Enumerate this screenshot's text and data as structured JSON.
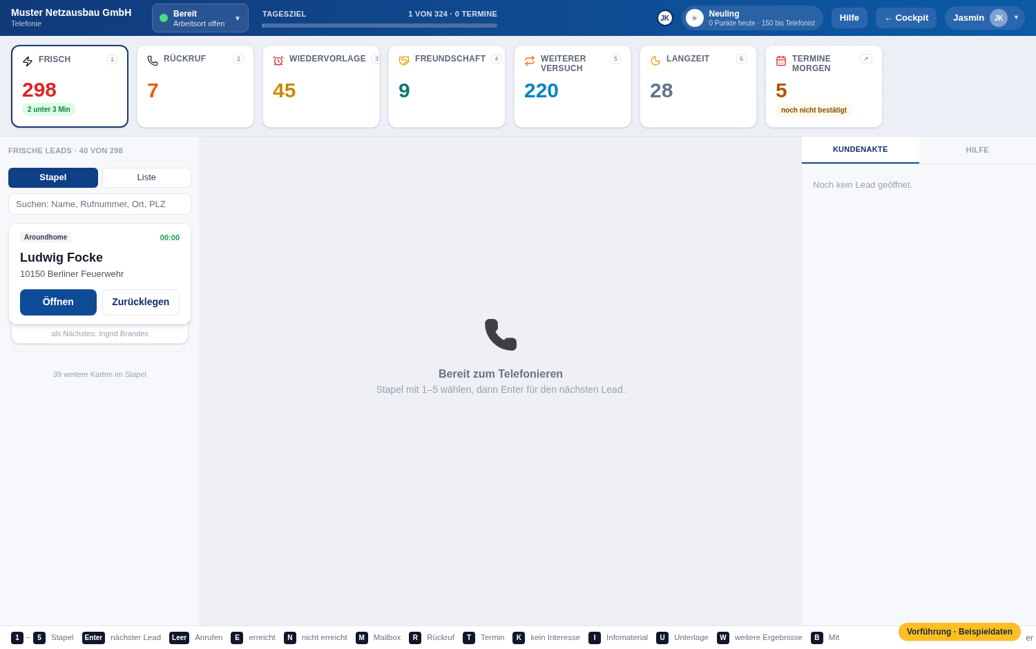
{
  "header": {
    "company": "Muster Netzausbau GmbH",
    "subtitle": "Telefonie",
    "status": {
      "label": "Bereit",
      "sublabel": "Arbeitsort offen",
      "color": "#4ade80",
      "caret": "▼"
    },
    "goal": {
      "label": "TAGESZIEL",
      "reading": "1 VON 324 · 0 TERMINE",
      "level": 0.003
    },
    "initials_badge": "JK",
    "rank": {
      "title": "Neuling",
      "detail": "0 Punkte heute · 150 bis Telefonist",
      "star": "★"
    },
    "buttons": [
      "Hilfe",
      "← Cockpit"
    ],
    "user": {
      "name": "Jasmin",
      "initials": "JK",
      "caret": "▼"
    }
  },
  "cards": [
    {
      "kind": "fresh",
      "title": "FRISCH",
      "shortcut": "1",
      "value": "298",
      "color": "#dc2626",
      "selected": true,
      "note": {
        "text": "2 unter 3 Min",
        "color": "#15803d"
      }
    },
    {
      "kind": "callback",
      "title": "RÜCKRUF",
      "shortcut": "2",
      "value": "7",
      "color": "#ea580c",
      "selected": false
    },
    {
      "kind": "followup",
      "title": "WIEDERVORLAGE",
      "shortcut": "3",
      "value": "45",
      "color": "#ca8a04",
      "selected": false
    },
    {
      "kind": "friendship",
      "title": "FREUNDSCHAFT",
      "shortcut": "4",
      "value": "9",
      "color": "#0f766e",
      "selected": false
    },
    {
      "kind": "retry",
      "title": "WEITERER VERSUCH",
      "shortcut": "5",
      "value": "220",
      "color": "#0284c7",
      "selected": false
    },
    {
      "kind": "longterm",
      "title": "LANGZEIT",
      "shortcut": "6",
      "value": "28",
      "color": "#64748b",
      "selected": false
    },
    {
      "kind": "appointments",
      "title": "TERMINE MORGEN",
      "shortcut": "↗",
      "value": "5",
      "color": "#b45309",
      "selected": false,
      "note": {
        "text": "noch nicht bestätigt",
        "color": "#854d0e"
      }
    }
  ],
  "left_panel": {
    "heading": "FRISCHE LEADS · 40 VON 298",
    "view_tabs": [
      {
        "label": "Stapel",
        "selected": true
      },
      {
        "label": "Liste",
        "selected": false
      }
    ],
    "search": {
      "placeholder": "Suchen: Name, Rufnummer, Ort, PLZ"
    },
    "lead": {
      "source": "Aroundhome",
      "timer": "00:00",
      "name": "Ludwig Focke",
      "address": "10150 Berliner Feuerwehr",
      "buttons": [
        {
          "label": "Öffnen",
          "selected": true
        },
        {
          "label": "Zurücklegen",
          "selected": false
        }
      ]
    },
    "next": "als Nächstes: Ingrid Brandes",
    "remaining": "39 weitere Karten im Stapel"
  },
  "center": {
    "title": "Bereit zum Telefonieren",
    "subtitle": "Stapel mit 1–5 wählen, dann Enter für den nächsten Lead."
  },
  "right_panel": {
    "tabs": [
      {
        "label": "KUNDENAKTE",
        "selected": true
      },
      {
        "label": "HILFE",
        "selected": false
      }
    ],
    "empty": "Noch kein Lead geöffnet."
  },
  "footer": {
    "shortcuts": [
      {
        "keys": [
          "1",
          "5"
        ],
        "label": "Stapel"
      },
      {
        "keys": [
          "Enter"
        ],
        "label": "nächster Lead"
      },
      {
        "keys": [
          "Leer"
        ],
        "label": "Anrufen"
      },
      {
        "keys": [
          "E"
        ],
        "label": "erreicht"
      },
      {
        "keys": [
          "N"
        ],
        "label": "nicht erreicht"
      },
      {
        "keys": [
          "M"
        ],
        "label": "Mailbox"
      },
      {
        "keys": [
          "R"
        ],
        "label": "Rückruf"
      },
      {
        "keys": [
          "T"
        ],
        "label": "Termin"
      },
      {
        "keys": [
          "K"
        ],
        "label": "kein Interesse"
      },
      {
        "keys": [
          "I"
        ],
        "label": "Infomaterial"
      },
      {
        "keys": [
          "U"
        ],
        "label": "Unterlage"
      },
      {
        "keys": [
          "W"
        ],
        "label": "weitere Ergebnisse"
      },
      {
        "keys": [
          "B"
        ],
        "label": "Mit"
      }
    ],
    "tail": "er",
    "demo_badge": "Vorführung · Beispieldaten"
  }
}
